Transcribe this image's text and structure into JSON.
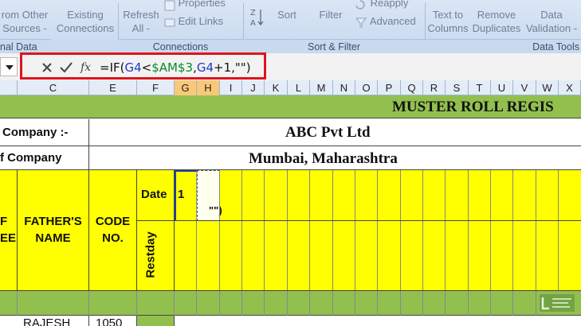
{
  "ribbon": {
    "buttons": {
      "from_other_sources": "rom Other\nSources -",
      "existing_connections": "Existing\nConnections",
      "refresh_all": "Refresh\nAll -",
      "properties": "Properties",
      "edit_links": "Edit Links",
      "sort": "Sort",
      "filter": "Filter",
      "reapply": "Reapply",
      "advanced": "Advanced",
      "text_to_columns": "Text to\nColumns",
      "remove_duplicates": "Remove\nDuplicates",
      "data_validation": "Data\nValidation -"
    },
    "groups": {
      "external_data": "nal Data",
      "connections": "Connections",
      "sort_filter": "Sort & Filter",
      "data_tools": "Data Tools"
    }
  },
  "formula_bar": {
    "formula_prefix": "=IF(",
    "ref1": "G4",
    "mid1": "<",
    "abs_ref": "$AM$3",
    "mid2": ",",
    "ref2": "G4",
    "suffix": "+1,\"\")"
  },
  "columns": [
    "C",
    "E",
    "F",
    "G",
    "H",
    "I",
    "J",
    "K",
    "L",
    "M",
    "N",
    "O",
    "P",
    "Q",
    "R",
    "S",
    "T",
    "U",
    "V",
    "W",
    "X"
  ],
  "sheet": {
    "title": "MUSTER ROLL REGIS",
    "company_label": "Company :-",
    "company_value": "ABC Pvt Ltd",
    "address_label": "f Company",
    "address_value": "Mumbai, Maharashtra",
    "header_name_partial": "F\nEE",
    "header_fathers_name": "FATHER'S\nNAME",
    "header_code_no": "CODE\nNO.",
    "header_date": "Date",
    "header_restday": "Restday",
    "date_first": "1",
    "editing_text": "\"\")",
    "row1_name": "RAJESH",
    "row1_code": "1050"
  },
  "colors": {
    "header_green": "#92c04f",
    "header_yellow": "#ffff00",
    "selected_column": "#f9c979",
    "highlight_red": "#e0141c"
  },
  "icons": [
    "dropdown-arrow-icon",
    "cancel-icon",
    "enter-icon",
    "function-icon",
    "sort-icon",
    "filter-icon",
    "properties-icon",
    "edit-links-icon",
    "reapply-icon",
    "advanced-icon"
  ]
}
